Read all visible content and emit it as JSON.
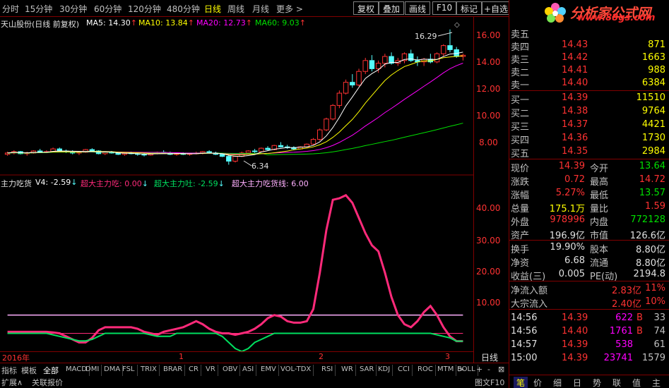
{
  "topbar": {
    "periods": [
      "分时",
      "15分钟",
      "30分钟",
      "60分钟",
      "120分钟",
      "480分钟",
      "日线",
      "周线",
      "月线",
      "更多 >"
    ],
    "active_period": "日线",
    "buttons": [
      "复权",
      "叠加",
      "画线",
      "F10",
      "标记",
      "+自选"
    ]
  },
  "chart_legend": {
    "title": "天山股份(日线 前复权)",
    "ma5": "MA5: 14.30",
    "ma10": "MA10: 13.84",
    "ma20": "MA20: 12.73",
    "ma60": "MA60: 9.03",
    "high_label": "16.29",
    "low_label": "6.34"
  },
  "indicator_legend": {
    "name": "主力吃货",
    "v4": "V4: -2.59",
    "super_eat": "超大主力吃: 0.00",
    "super_spit": "超大主力吐: -2.59",
    "super_line": "超大主力吃货线: 6.00"
  },
  "price_axis": [
    "16.00",
    "14.00",
    "12.00",
    "10.00",
    "8.00"
  ],
  "ind_axis": [
    "40.00",
    "30.00",
    "20.00",
    "10.00"
  ],
  "x_axis": {
    "year": "2016年",
    "m1": "1",
    "m2": "2",
    "m3": "3",
    "period": "日线"
  },
  "colors": {
    "up": "#ff3232",
    "down": "#54fcfc",
    "ma5": "#ffffff",
    "ma10": "#ffff00",
    "ma20": "#ff00ff",
    "ma60": "#00e000",
    "pink": "#ff2a7a",
    "green": "#00e060",
    "purple_line": "#ffb0ff"
  },
  "chart_data": {
    "type": "line",
    "candles": [
      [
        7.1,
        7.3,
        7.0,
        7.2
      ],
      [
        7.2,
        7.4,
        7.1,
        7.3
      ],
      [
        7.3,
        7.35,
        7.1,
        7.15
      ],
      [
        7.15,
        7.3,
        7.0,
        7.2
      ],
      [
        7.2,
        7.4,
        7.15,
        7.35
      ],
      [
        7.35,
        7.5,
        7.2,
        7.25
      ],
      [
        7.25,
        7.4,
        7.2,
        7.3
      ],
      [
        7.3,
        7.6,
        7.25,
        7.5
      ],
      [
        7.5,
        7.6,
        7.3,
        7.35
      ],
      [
        7.35,
        7.45,
        7.2,
        7.3
      ],
      [
        7.3,
        7.4,
        7.1,
        7.2
      ],
      [
        7.2,
        7.35,
        7.05,
        7.25
      ],
      [
        7.25,
        7.5,
        7.2,
        7.45
      ],
      [
        7.45,
        7.55,
        7.3,
        7.35
      ],
      [
        7.35,
        7.4,
        7.1,
        7.15
      ],
      [
        7.15,
        7.3,
        7.05,
        7.25
      ],
      [
        7.25,
        7.35,
        7.15,
        7.2
      ],
      [
        7.2,
        7.3,
        7.05,
        7.1
      ],
      [
        7.1,
        7.25,
        7.0,
        7.2
      ],
      [
        7.2,
        7.3,
        7.1,
        7.15
      ],
      [
        7.15,
        7.25,
        7.0,
        7.1
      ],
      [
        7.1,
        7.2,
        6.95,
        7.05
      ],
      [
        7.05,
        7.2,
        7.0,
        7.15
      ],
      [
        7.15,
        7.3,
        7.1,
        7.25
      ],
      [
        7.25,
        7.4,
        7.15,
        7.2
      ],
      [
        7.2,
        7.3,
        7.05,
        7.1
      ],
      [
        7.1,
        7.2,
        7.0,
        7.15
      ],
      [
        7.15,
        7.25,
        7.05,
        7.1
      ],
      [
        7.1,
        7.2,
        7.0,
        7.18
      ],
      [
        7.18,
        7.3,
        7.1,
        7.2
      ],
      [
        7.2,
        7.35,
        7.1,
        7.3
      ],
      [
        7.3,
        7.4,
        7.15,
        7.2
      ],
      [
        7.2,
        7.3,
        7.05,
        7.1
      ],
      [
        7.1,
        7.2,
        6.9,
        6.95
      ],
      [
        6.95,
        7.1,
        6.34,
        6.6
      ],
      [
        6.6,
        7.0,
        6.5,
        6.95
      ],
      [
        6.95,
        7.3,
        6.9,
        7.2
      ],
      [
        7.2,
        7.4,
        7.1,
        7.35
      ],
      [
        7.35,
        7.5,
        7.2,
        7.3
      ],
      [
        7.3,
        7.6,
        7.25,
        7.55
      ],
      [
        7.55,
        7.7,
        7.4,
        7.45
      ],
      [
        7.45,
        7.8,
        7.4,
        7.75
      ],
      [
        7.75,
        8.0,
        7.6,
        7.65
      ],
      [
        7.65,
        7.8,
        7.5,
        7.6
      ],
      [
        7.6,
        7.7,
        7.4,
        7.5
      ],
      [
        7.5,
        7.7,
        7.45,
        7.65
      ],
      [
        7.65,
        7.9,
        7.6,
        7.85
      ],
      [
        7.85,
        8.3,
        7.8,
        8.2
      ],
      [
        8.2,
        9.0,
        8.1,
        8.9
      ],
      [
        8.9,
        9.8,
        8.8,
        9.7
      ],
      [
        9.7,
        10.8,
        9.6,
        10.7
      ],
      [
        10.7,
        11.8,
        10.5,
        11.6
      ],
      [
        11.6,
        12.6,
        11.5,
        12.4
      ],
      [
        12.4,
        13.0,
        12.0,
        12.2
      ],
      [
        12.2,
        13.4,
        12.1,
        13.2
      ],
      [
        13.2,
        14.2,
        13.0,
        14.0
      ],
      [
        14.0,
        14.4,
        13.2,
        13.4
      ],
      [
        13.4,
        14.0,
        13.1,
        13.8
      ],
      [
        13.8,
        14.5,
        13.5,
        14.3
      ],
      [
        14.3,
        14.6,
        13.7,
        13.8
      ],
      [
        13.8,
        14.2,
        13.6,
        14.0
      ],
      [
        14.0,
        14.6,
        13.8,
        14.5
      ],
      [
        14.5,
        14.8,
        13.9,
        14.0
      ],
      [
        14.0,
        14.3,
        13.6,
        13.9
      ],
      [
        13.9,
        14.2,
        13.6,
        14.1
      ],
      [
        14.1,
        14.5,
        13.8,
        13.9
      ],
      [
        13.9,
        14.6,
        13.8,
        14.5
      ],
      [
        14.5,
        15.2,
        14.3,
        15.1
      ],
      [
        15.1,
        16.29,
        14.6,
        14.8
      ],
      [
        14.8,
        15.0,
        14.2,
        14.3
      ],
      [
        14.3,
        14.5,
        14.0,
        14.39
      ]
    ],
    "series": [
      {
        "name": "超大主力吃货线",
        "values": [
          6.0,
          6.0,
          6.0,
          6.0,
          6.0,
          6.0,
          6.0,
          6.0,
          6.0,
          6.0,
          6.0,
          6.0,
          6.0,
          6.0,
          6.0,
          6.0,
          6.0,
          6.0,
          6.0,
          6.0,
          6.0,
          6.0,
          6.0,
          6.0,
          6.0,
          6.0,
          6.0,
          6.0,
          6.0,
          6.0,
          6.0,
          6.0,
          6.0,
          6.0,
          6.0,
          6.0,
          6.0,
          6.0,
          6.0,
          6.0,
          6.0,
          6.0,
          6.0,
          6.0,
          6.0,
          6.0,
          6.0,
          6.0,
          6.0,
          6.0,
          6.0,
          6.0,
          6.0,
          6.0,
          6.0,
          6.0,
          6.0,
          6.0,
          6.0,
          6.0,
          6.0,
          6.0,
          6.0,
          6.0,
          6.0,
          6.0,
          6.0,
          6.0,
          6.0,
          6.0,
          6.0
        ]
      },
      {
        "name": "超大主力吃",
        "values": [
          0,
          0,
          0,
          0,
          0,
          0,
          0,
          0,
          0,
          0,
          0,
          0,
          0,
          0,
          0,
          0,
          0,
          0,
          0,
          0,
          0,
          0,
          0,
          0,
          0,
          0,
          0,
          0,
          0,
          0,
          0,
          0,
          0,
          0,
          0,
          0,
          0,
          0,
          0,
          0,
          0,
          0,
          0,
          0,
          0,
          0,
          0,
          0,
          0,
          0,
          0,
          0,
          0,
          0,
          0,
          0,
          0,
          0,
          0,
          0,
          0,
          0,
          0,
          0,
          0,
          0,
          0,
          0,
          0,
          0,
          0
        ]
      },
      {
        "name": "V4",
        "values": [
          0.5,
          0.5,
          0.5,
          0.5,
          0.5,
          0.5,
          0.5,
          0.3,
          0,
          -1,
          -2,
          -3,
          -3,
          -1.5,
          1,
          2,
          2,
          2,
          2,
          2,
          1.5,
          0.5,
          0,
          -0.5,
          0.5,
          1,
          1.5,
          2,
          3,
          4,
          3,
          1.5,
          0.5,
          0,
          0,
          -0.5,
          0,
          0.5,
          1.5,
          3,
          5,
          6,
          5.5,
          4,
          3.5,
          3.5,
          4,
          8,
          20,
          34,
          44,
          44.5,
          45.5,
          43,
          38,
          33,
          29,
          27,
          20,
          12,
          6,
          3,
          2,
          4,
          7,
          9,
          6,
          2,
          -1,
          -2.59,
          -2.59
        ]
      },
      {
        "name": "超大主力吐",
        "values": [
          0,
          0,
          0,
          0,
          0,
          0,
          0,
          -0.5,
          -1,
          -1.5,
          -2,
          -2.5,
          -2.5,
          -2,
          -1,
          0,
          0,
          0,
          0,
          0,
          0,
          0,
          -0.5,
          -1,
          -1,
          -1,
          0,
          0,
          0,
          0,
          0,
          0,
          0,
          -1,
          -3,
          -5,
          -6,
          -5,
          -3,
          -2,
          -1,
          0,
          0,
          0,
          0,
          0,
          0,
          0,
          0,
          0,
          0,
          0,
          0,
          0,
          0,
          0,
          0,
          0,
          0,
          0,
          0,
          0,
          0,
          0,
          0,
          0,
          -0.5,
          -1,
          -1.5,
          -2.59,
          -2.59
        ]
      }
    ],
    "price_ylim": [
      6.0,
      17.0
    ],
    "ind_ylim": [
      -5,
      48
    ]
  },
  "quote": {
    "asks": [
      {
        "label": "卖五",
        "price": "",
        "vol": ""
      },
      {
        "label": "卖四",
        "price": "14.43",
        "vol": "871"
      },
      {
        "label": "卖三",
        "price": "14.42",
        "vol": "1663"
      },
      {
        "label": "卖二",
        "price": "14.41",
        "vol": "988"
      },
      {
        "label": "卖一",
        "price": "14.40",
        "vol": "6384"
      }
    ],
    "bids": [
      {
        "label": "买一",
        "price": "14.39",
        "vol": "11510"
      },
      {
        "label": "买二",
        "price": "14.38",
        "vol": "9764"
      },
      {
        "label": "买三",
        "price": "14.37",
        "vol": "4421"
      },
      {
        "label": "买四",
        "price": "14.36",
        "vol": "1730"
      },
      {
        "label": "买五",
        "price": "14.35",
        "vol": "2984"
      }
    ],
    "stats": [
      {
        "l1": "现价",
        "v1": "14.39",
        "c1": "#ff3232",
        "l2": "今开",
        "v2": "13.64",
        "c2": "#00e000"
      },
      {
        "l1": "涨跌",
        "v1": "0.72",
        "c1": "#ff3232",
        "l2": "最高",
        "v2": "14.72",
        "c2": "#ff3232"
      },
      {
        "l1": "涨幅",
        "v1": "5.27%",
        "c1": "#ff3232",
        "l2": "最低",
        "v2": "13.57",
        "c2": "#00e000"
      },
      {
        "l1": "总量",
        "v1": "175.1万",
        "c1": "#ffff00",
        "l2": "量比",
        "v2": "1.59",
        "c2": "#ff3232"
      },
      {
        "l1": "外盘",
        "v1": "978996",
        "c1": "#ff3232",
        "l2": "内盘",
        "v2": "772128",
        "c2": "#00e000"
      },
      {
        "l1": "资产",
        "v1": "196.9亿",
        "c1": "#e0e0e0",
        "l2": "市值",
        "v2": "126.6亿",
        "c2": "#e0e0e0"
      }
    ],
    "stats2": [
      {
        "l1": "换手",
        "v1": "19.90%",
        "l2": "股本",
        "v2": "8.80亿"
      },
      {
        "l1": "净资",
        "v1": "6.68",
        "l2": "流通",
        "v2": "8.80亿"
      },
      {
        "l1": "收益(三)",
        "v1": "0.005",
        "l2": "PE(动)",
        "v2": "2194.8"
      }
    ],
    "flows": [
      {
        "label": "净流入额",
        "v1": "2.83亿",
        "v2": "11%"
      },
      {
        "label": "大宗流入",
        "v1": "2.40亿",
        "v2": "10%"
      }
    ],
    "ticks": [
      {
        "time": "14:56",
        "price": "14.39",
        "vol": "622",
        "bs": "B",
        "n": "33",
        "vc": "#ff00ff"
      },
      {
        "time": "14:56",
        "price": "14.40",
        "vol": "1761",
        "bs": "B",
        "n": "74",
        "vc": "#ff00ff"
      },
      {
        "time": "14:57",
        "price": "14.39",
        "vol": "538",
        "bs": "",
        "n": "61",
        "vc": "#ff00ff"
      },
      {
        "time": "15:00",
        "price": "14.39",
        "vol": "23741",
        "bs": "",
        "n": "1579",
        "vc": "#ff00ff"
      }
    ],
    "tabs": [
      "笔",
      "价",
      "细",
      "日",
      "势",
      "联",
      "值",
      "主"
    ]
  },
  "logo": {
    "title": "分析家公式网",
    "url": "www.88gs.com"
  },
  "bottombar": {
    "left_tabs": [
      "指标",
      "模板",
      "全部"
    ],
    "indicators": [
      "MACD",
      "DMI",
      "DMA",
      "FSL",
      "TRIX",
      "BRAR",
      "CR",
      "VR",
      "OBV",
      "ASI",
      "EMV",
      "VOL-TDX",
      "RSI",
      "WR",
      "SAR",
      "KDJ",
      "CCI",
      "ROC",
      "MTM",
      "BOLL"
    ],
    "more": ">",
    "ctrl": [
      "+",
      "-",
      "⊠"
    ],
    "row2_left": [
      "扩展∧",
      "关联报价"
    ],
    "row2_right": "图文F10"
  }
}
